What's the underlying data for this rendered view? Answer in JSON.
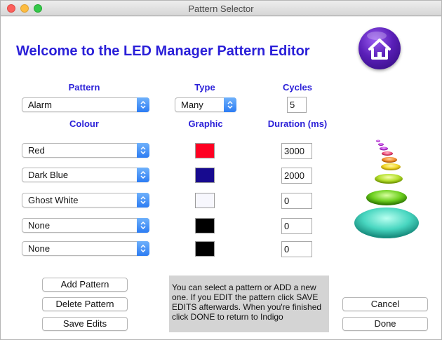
{
  "window": {
    "title": "Pattern Selector"
  },
  "heading": "Welcome to the LED Manager Pattern Editor",
  "labels": {
    "pattern": "Pattern",
    "type": "Type",
    "cycles": "Cycles",
    "colour": "Colour",
    "graphic": "Graphic",
    "duration": "Duration (ms)"
  },
  "pattern_select": {
    "value": "Alarm"
  },
  "type_select": {
    "value": "Many"
  },
  "cycles_field": {
    "value": "5"
  },
  "rows": [
    {
      "colour": "Red",
      "graphic_color": "#fe0022",
      "duration": "3000"
    },
    {
      "colour": "Dark Blue",
      "graphic_color": "#170a8f",
      "duration": "2000"
    },
    {
      "colour": "Ghost White",
      "graphic_color": "#f7f7fd",
      "duration": "0"
    },
    {
      "colour": "None",
      "graphic_color": "#000000",
      "duration": "0"
    },
    {
      "colour": "None",
      "graphic_color": "#000000",
      "duration": "0"
    }
  ],
  "buttons": {
    "add_pattern": "Add Pattern",
    "delete_pattern": "Delete Pattern",
    "save_edits": "Save Edits",
    "cancel": "Cancel",
    "done": "Done"
  },
  "info_text": "You can select a pattern or ADD a new one. If you EDIT the pattern click SAVE EDITS afterwards.  When you're finished click DONE to return to Indigo",
  "icons": {
    "home": "home-icon",
    "dropdown": "chevron-updown-icon",
    "led_stack": "led-pattern-stack-icon"
  },
  "colors": {
    "accent": "#2a1fd8",
    "dropdown": "#2c7cf3"
  }
}
